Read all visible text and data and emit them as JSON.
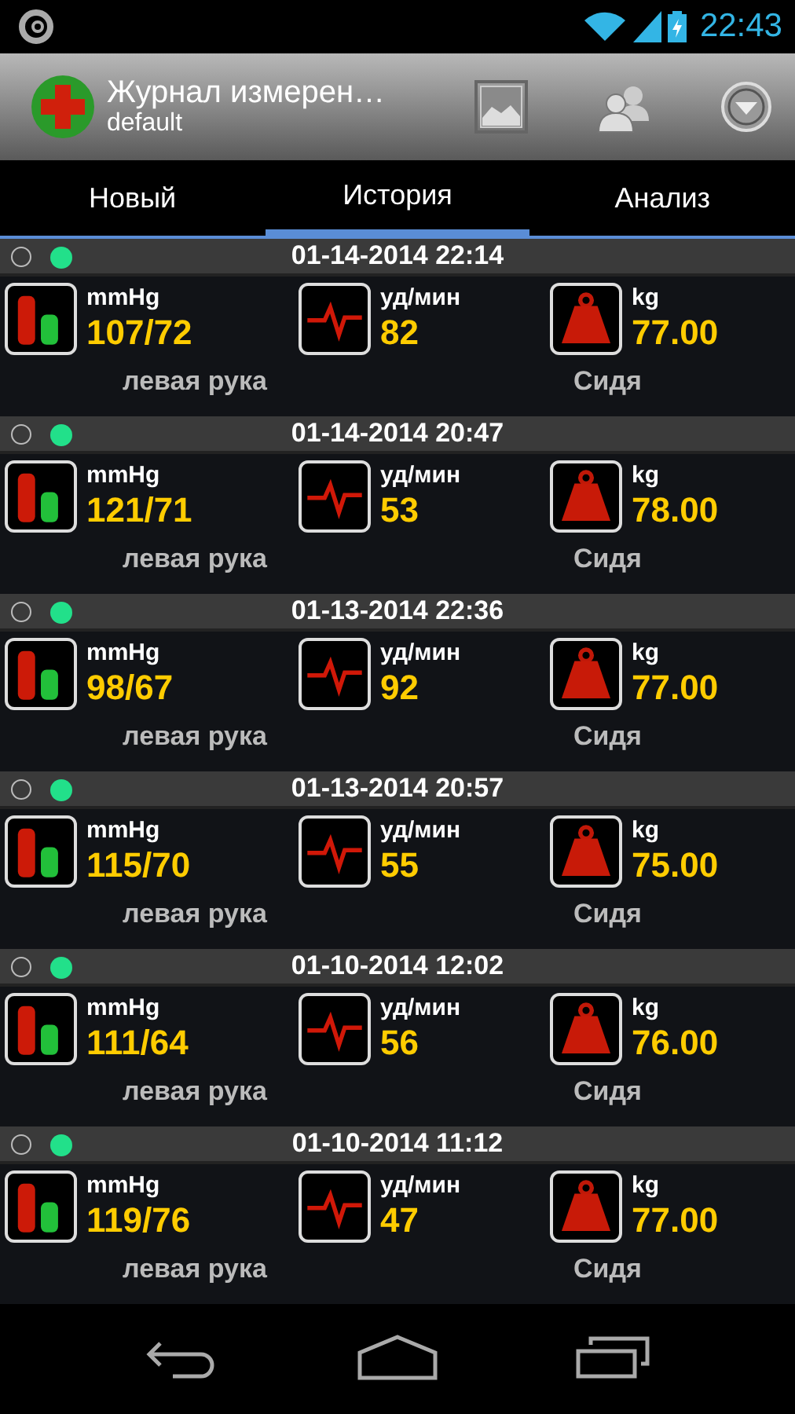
{
  "status_bar": {
    "time": "22:43"
  },
  "action_bar": {
    "title": "Журнал измерен…",
    "subtitle": "default"
  },
  "tabs": [
    {
      "label": "Новый",
      "selected": false
    },
    {
      "label": "История",
      "selected": true
    },
    {
      "label": "Анализ",
      "selected": false
    }
  ],
  "entries": [
    {
      "selected": false,
      "color": "#22e08a",
      "datetime": "01-14-2014 22:14",
      "measures": [
        {
          "kind": "pressure",
          "unit": "mmHg",
          "value": "107/72"
        },
        {
          "kind": "pulse",
          "unit": "уд/мин",
          "value": "82"
        },
        {
          "kind": "weight",
          "unit": "kg",
          "value": "77.00"
        }
      ],
      "notes": [
        "левая рука",
        "Сидя"
      ]
    },
    {
      "selected": false,
      "color": "#22e08a",
      "datetime": "01-14-2014 20:47",
      "measures": [
        {
          "kind": "pressure",
          "unit": "mmHg",
          "value": "121/71"
        },
        {
          "kind": "pulse",
          "unit": "уд/мин",
          "value": "53"
        },
        {
          "kind": "weight",
          "unit": "kg",
          "value": "78.00"
        }
      ],
      "notes": [
        "левая рука",
        "Сидя"
      ]
    },
    {
      "selected": false,
      "color": "#22e08a",
      "datetime": "01-13-2014 22:36",
      "measures": [
        {
          "kind": "pressure",
          "unit": "mmHg",
          "value": "98/67"
        },
        {
          "kind": "pulse",
          "unit": "уд/мин",
          "value": "92"
        },
        {
          "kind": "weight",
          "unit": "kg",
          "value": "77.00"
        }
      ],
      "notes": [
        "левая рука",
        "Сидя"
      ]
    },
    {
      "selected": false,
      "color": "#22e08a",
      "datetime": "01-13-2014 20:57",
      "measures": [
        {
          "kind": "pressure",
          "unit": "mmHg",
          "value": "115/70"
        },
        {
          "kind": "pulse",
          "unit": "уд/мин",
          "value": "55"
        },
        {
          "kind": "weight",
          "unit": "kg",
          "value": "75.00"
        }
      ],
      "notes": [
        "левая рука",
        "Сидя"
      ]
    },
    {
      "selected": false,
      "color": "#22e08a",
      "datetime": "01-10-2014 12:02",
      "measures": [
        {
          "kind": "pressure",
          "unit": "mmHg",
          "value": "111/64"
        },
        {
          "kind": "pulse",
          "unit": "уд/мин",
          "value": "56"
        },
        {
          "kind": "weight",
          "unit": "kg",
          "value": "76.00"
        }
      ],
      "notes": [
        "левая рука",
        "Сидя"
      ]
    },
    {
      "selected": false,
      "color": "#22e08a",
      "datetime": "01-10-2014 11:12",
      "measures": [
        {
          "kind": "pressure",
          "unit": "mmHg",
          "value": "119/76"
        },
        {
          "kind": "pulse",
          "unit": "уд/мин",
          "value": "47"
        },
        {
          "kind": "weight",
          "unit": "kg",
          "value": "77.00"
        }
      ],
      "notes": [
        "левая рука",
        "Сидя"
      ]
    }
  ]
}
